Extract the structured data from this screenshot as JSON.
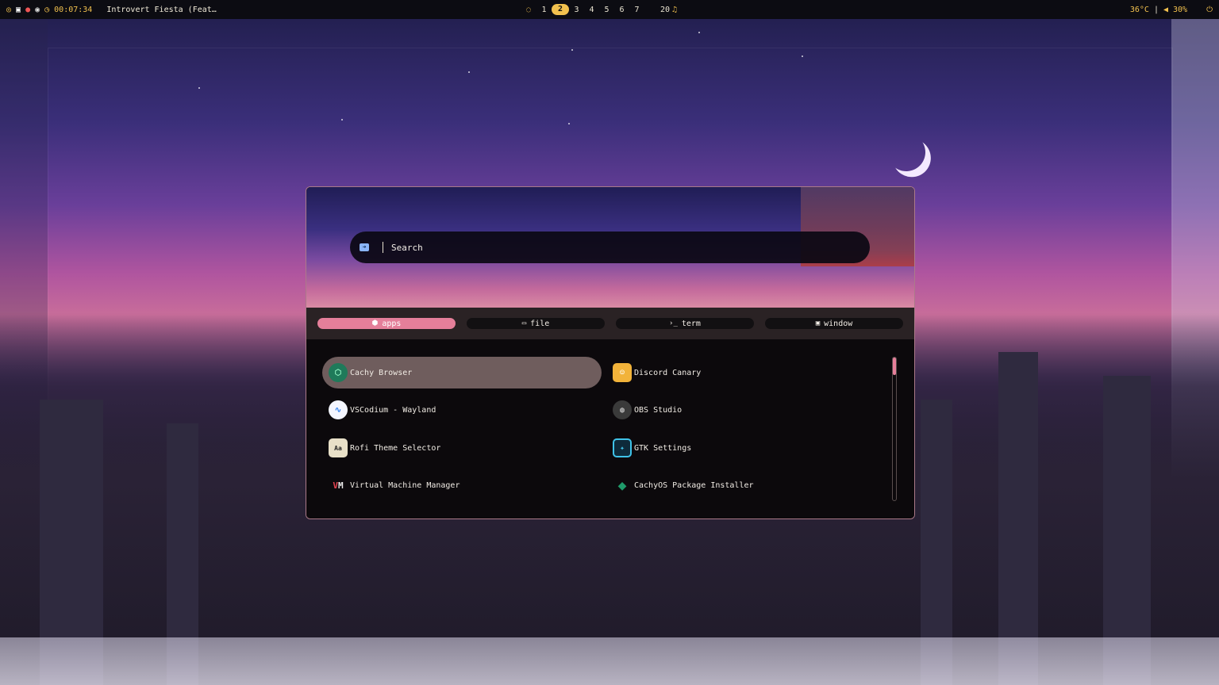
{
  "topbar": {
    "clock": "00:07:34",
    "media_title": "Introvert Fiesta (Feat…",
    "workspaces": [
      {
        "label": "1",
        "active": false
      },
      {
        "label": "2",
        "active": true
      },
      {
        "label": "3",
        "active": false
      },
      {
        "label": "4",
        "active": false
      },
      {
        "label": "5",
        "active": false
      },
      {
        "label": "6",
        "active": false
      },
      {
        "label": "7",
        "active": false
      }
    ],
    "notifications": "20",
    "temperature": "36°C",
    "separator": "|",
    "volume": "30%",
    "icons": [
      "eye-off-icon",
      "window-icon",
      "recording-icon",
      "discord-icon",
      "clock-icon",
      "power-icon"
    ]
  },
  "launcher": {
    "search": {
      "placeholder": "Search",
      "value": ""
    },
    "modes": [
      {
        "label": "apps",
        "icon": "cube-icon",
        "active": true
      },
      {
        "label": "file",
        "icon": "folder-icon",
        "active": false
      },
      {
        "label": "term",
        "icon": "terminal-icon",
        "active": false
      },
      {
        "label": "window",
        "icon": "window-icon",
        "active": false
      }
    ],
    "apps": [
      {
        "label": "Cachy Browser",
        "icon": "cachy-browser-icon",
        "selected": true
      },
      {
        "label": "Discord Canary",
        "icon": "discord-canary-icon",
        "selected": false
      },
      {
        "label": "VSCodium - Wayland",
        "icon": "vscodium-icon",
        "selected": false
      },
      {
        "label": "OBS Studio",
        "icon": "obs-icon",
        "selected": false
      },
      {
        "label": "Rofi Theme Selector",
        "icon": "rofi-icon",
        "selected": false
      },
      {
        "label": "GTK Settings",
        "icon": "gtk-settings-icon",
        "selected": false
      },
      {
        "label": "Virtual Machine Manager",
        "icon": "virt-manager-icon",
        "selected": false
      },
      {
        "label": "CachyOS Package Installer",
        "icon": "package-installer-icon",
        "selected": false
      }
    ],
    "scroll_fraction": 0.12
  }
}
